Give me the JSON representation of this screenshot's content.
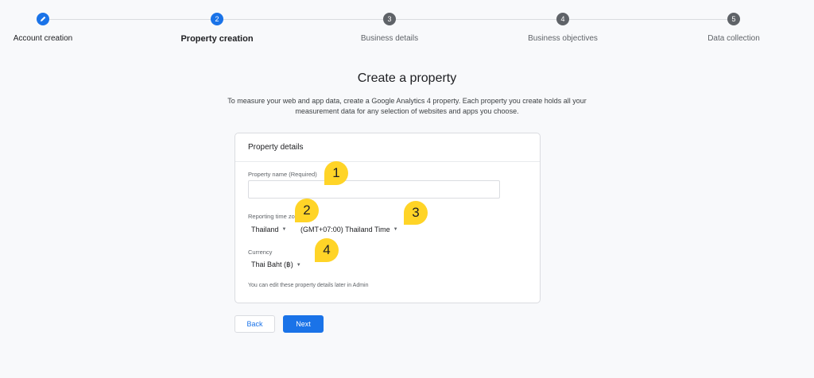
{
  "stepper": {
    "steps": [
      {
        "number": "",
        "label": "Account creation",
        "state": "done"
      },
      {
        "number": "2",
        "label": "Property creation",
        "state": "current"
      },
      {
        "number": "3",
        "label": "Business details",
        "state": "todo"
      },
      {
        "number": "4",
        "label": "Business objectives",
        "state": "todo"
      },
      {
        "number": "5",
        "label": "Data collection",
        "state": "todo"
      }
    ]
  },
  "page": {
    "title": "Create a property",
    "intro_line1": "To measure your web and app data, create a Google Analytics 4 property. Each property you create holds all your",
    "intro_line2": "measurement data for any selection of websites and apps you choose."
  },
  "card": {
    "header": "Property details",
    "property_name_label": "Property name (Required)",
    "property_name_value": "",
    "timezone_label": "Reporting time zo",
    "country_value": "Thailand",
    "timezone_value": "(GMT+07:00) Thailand Time",
    "currency_label": "Currency",
    "currency_value": "Thai Baht (฿)",
    "note": "You can edit these property details later in Admin"
  },
  "buttons": {
    "back": "Back",
    "next": "Next"
  },
  "annotations": [
    "1",
    "2",
    "3",
    "4"
  ],
  "colors": {
    "accent": "#1a73e8",
    "badge": "#ffd427",
    "inactive_step": "#5f6368"
  },
  "icons": {
    "step1": "pencil-icon",
    "dropdown": "caret-down-icon"
  }
}
